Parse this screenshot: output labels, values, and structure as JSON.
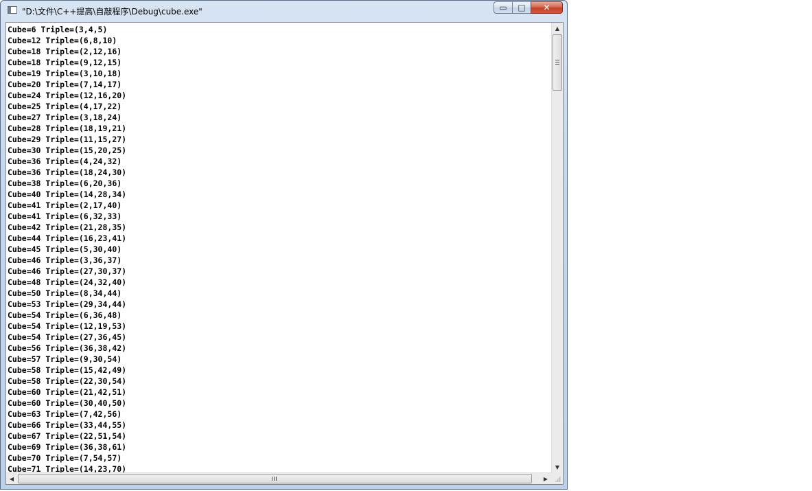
{
  "window": {
    "title": "\"D:\\文件\\C++提高\\自敲程序\\Debug\\cube.exe\"",
    "min_symbol": "▭",
    "max_symbol": "□",
    "close_symbol": "✕",
    "icons": {
      "app": "console-window-icon",
      "minimize": "minimize-icon",
      "maximize": "maximize-icon",
      "close": "close-icon"
    },
    "colors": {
      "frame": "#c3d6ec",
      "close_button": "#c4422a",
      "console_bg": "#ffffff",
      "console_text": "#000000"
    }
  },
  "console": {
    "lines": [
      "Cube=6 Triple=(3,4,5)",
      "Cube=12 Triple=(6,8,10)",
      "Cube=18 Triple=(2,12,16)",
      "Cube=18 Triple=(9,12,15)",
      "Cube=19 Triple=(3,10,18)",
      "Cube=20 Triple=(7,14,17)",
      "Cube=24 Triple=(12,16,20)",
      "Cube=25 Triple=(4,17,22)",
      "Cube=27 Triple=(3,18,24)",
      "Cube=28 Triple=(18,19,21)",
      "Cube=29 Triple=(11,15,27)",
      "Cube=30 Triple=(15,20,25)",
      "Cube=36 Triple=(4,24,32)",
      "Cube=36 Triple=(18,24,30)",
      "Cube=38 Triple=(6,20,36)",
      "Cube=40 Triple=(14,28,34)",
      "Cube=41 Triple=(2,17,40)",
      "Cube=41 Triple=(6,32,33)",
      "Cube=42 Triple=(21,28,35)",
      "Cube=44 Triple=(16,23,41)",
      "Cube=45 Triple=(5,30,40)",
      "Cube=46 Triple=(3,36,37)",
      "Cube=46 Triple=(27,30,37)",
      "Cube=48 Triple=(24,32,40)",
      "Cube=50 Triple=(8,34,44)",
      "Cube=53 Triple=(29,34,44)",
      "Cube=54 Triple=(6,36,48)",
      "Cube=54 Triple=(12,19,53)",
      "Cube=54 Triple=(27,36,45)",
      "Cube=56 Triple=(36,38,42)",
      "Cube=57 Triple=(9,30,54)",
      "Cube=58 Triple=(15,42,49)",
      "Cube=58 Triple=(22,30,54)",
      "Cube=60 Triple=(21,42,51)",
      "Cube=60 Triple=(30,40,50)",
      "Cube=63 Triple=(7,42,56)",
      "Cube=66 Triple=(33,44,55)",
      "Cube=67 Triple=(22,51,54)",
      "Cube=69 Triple=(36,38,61)",
      "Cube=70 Triple=(7,54,57)",
      "Cube=71 Triple=(14,23,70)"
    ]
  },
  "scrollbars": {
    "up_arrow": "▲",
    "down_arrow": "▼",
    "left_arrow": "◀",
    "right_arrow": "▶",
    "vertical_position": 0.0,
    "horizontal_position": 0.0
  }
}
